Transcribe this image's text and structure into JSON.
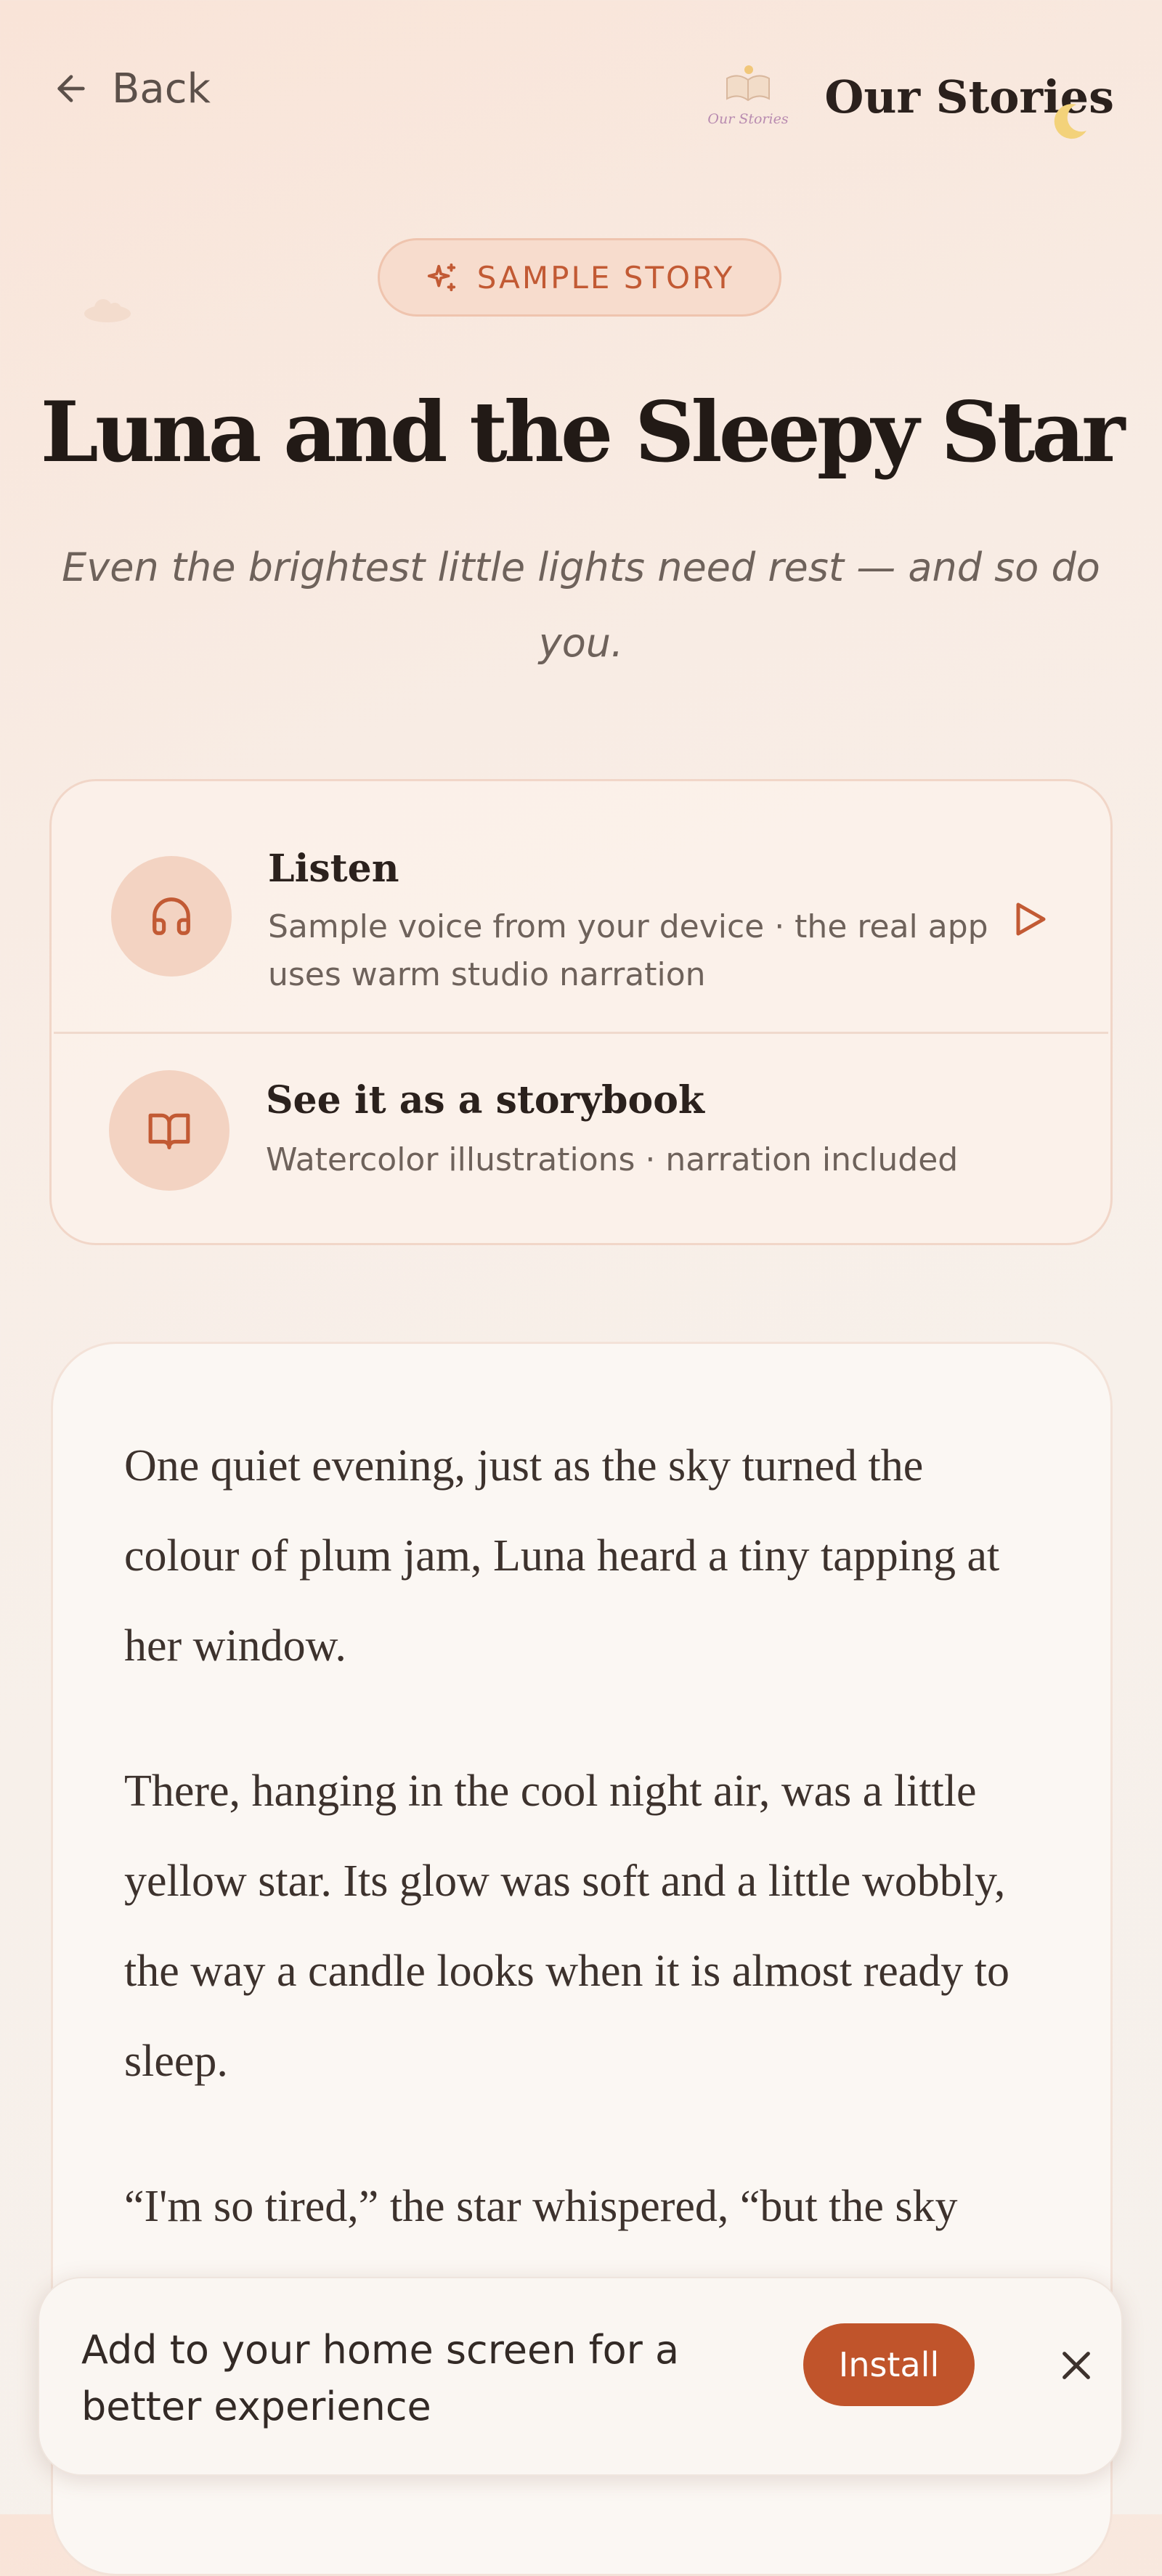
{
  "header": {
    "back_label": "Back",
    "brand_name": "Our Stories",
    "brand_logo_text": "Our Stories"
  },
  "badge": {
    "label": "SAMPLE STORY"
  },
  "story": {
    "title": "Luna and the Sleepy Star",
    "subtitle": "Even the brightest little lights need rest — and so do you.",
    "paragraphs": [
      "One quiet evening, just as the sky turned the colour of plum jam, Luna heard a tiny tapping at her window.",
      "There, hanging in the cool night air, was a little yellow star. Its glow was soft and a little wobbly, the way a candle looks when it is almost ready to sleep.",
      "“I'm so tired,” the star whispered, “but the sky"
    ]
  },
  "options": [
    {
      "title": "Listen",
      "description": "Sample voice from your device · the real app uses warm studio narration",
      "icon": "headphones-icon"
    },
    {
      "title": "See it as a storybook",
      "description": "Watercolor illustrations · narration included",
      "icon": "book-open-icon"
    }
  ],
  "install_banner": {
    "text": "Add to your home screen for a better experience",
    "button_label": "Install"
  },
  "colors": {
    "accent": "#c0542b",
    "badge_text": "#c25a34",
    "title": "#221a16",
    "muted": "#6e625b"
  }
}
